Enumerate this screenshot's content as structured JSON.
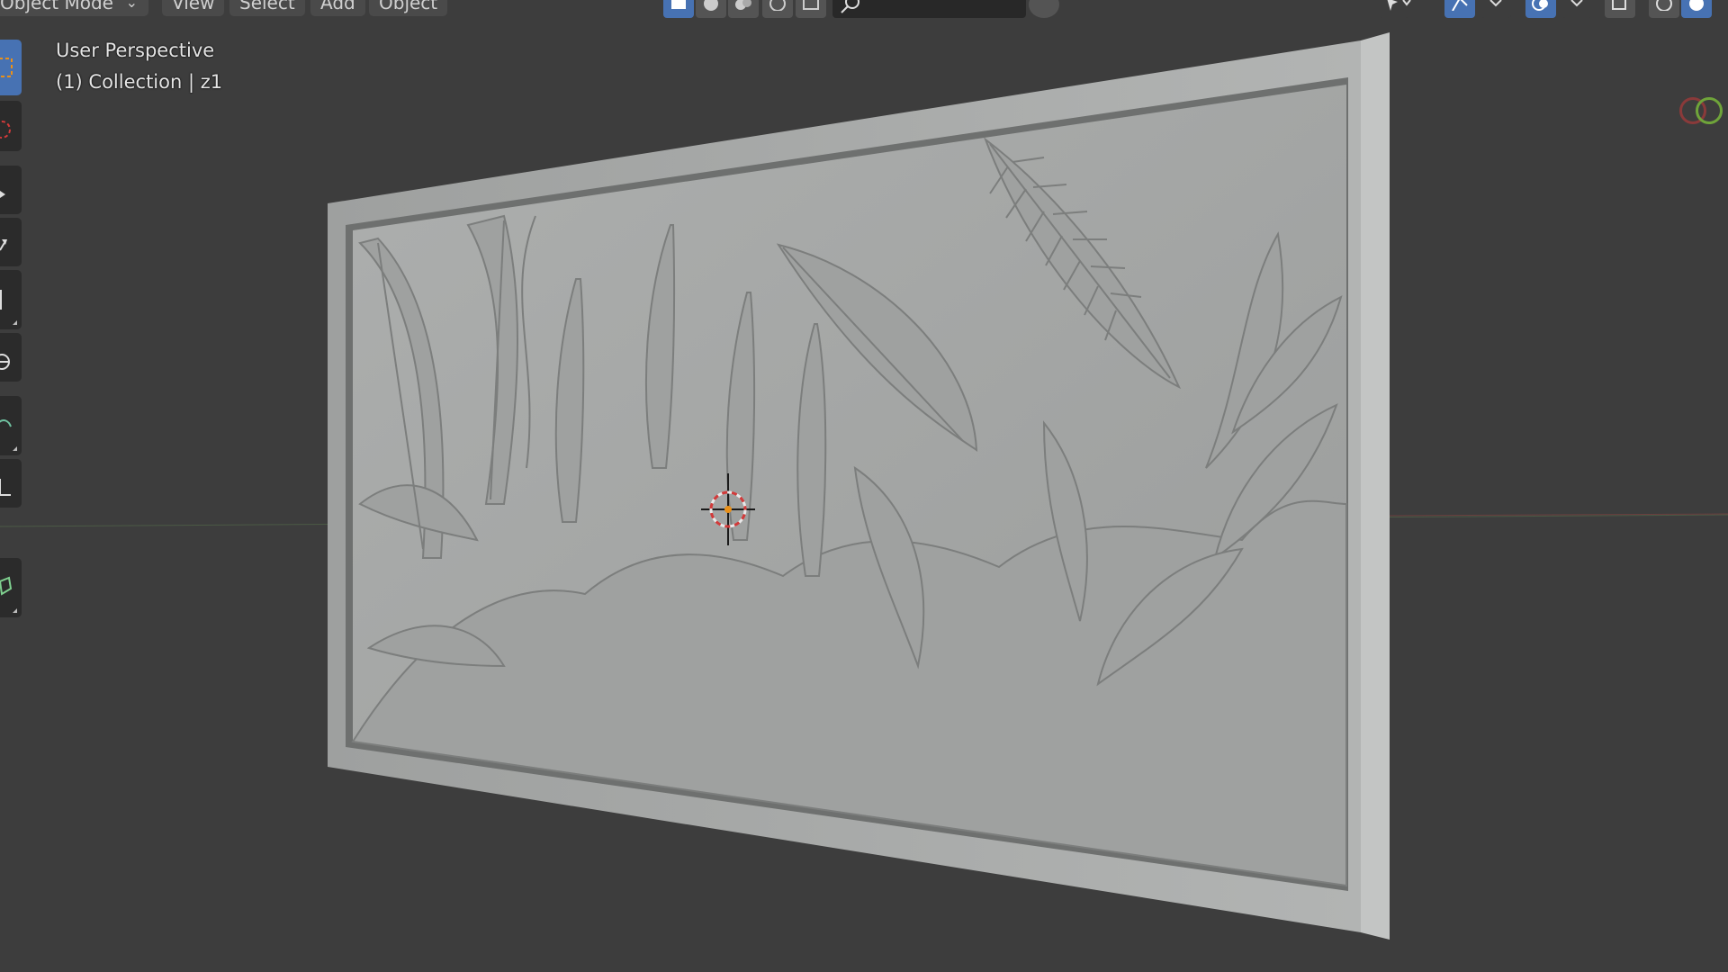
{
  "header": {
    "mode_label": "Object Mode",
    "menus": {
      "view": "View",
      "select": "Select",
      "add": "Add",
      "object": "Object"
    }
  },
  "viewport_overlay": {
    "view_name": "User Perspective",
    "collection_line": "(1) Collection | z1"
  },
  "icons": {
    "header_left": [
      "select-box-icon",
      "globe-icon",
      "link-icon",
      "sphere-icon",
      "grid-icon"
    ],
    "search": "search-icon",
    "header_right": [
      "cursor-icon",
      "snap-icon",
      "overlay-icon",
      "xray-icon",
      "wireframe-icon",
      "solid-icon"
    ],
    "toolbar": [
      "select-box-icon",
      "cursor-icon",
      "move-icon",
      "rotate-icon",
      "scale-icon",
      "transform-icon",
      "annotate-icon",
      "measure-icon",
      "add-cube-icon"
    ]
  },
  "colors": {
    "viewport_bg": "#3d3d3d",
    "active_blue": "#4772b3",
    "relief_gray": "#a9abaa",
    "axis_x": "#8a3a3a",
    "axis_y": "#6fa43a"
  }
}
